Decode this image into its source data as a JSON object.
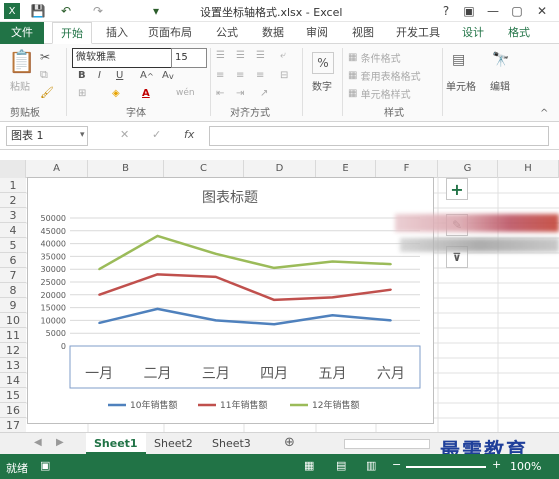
{
  "window": {
    "title": "设置坐标轴格式.xlsx - Excel",
    "help": "?",
    "minimize": "—",
    "restore": "▢",
    "close": "✕"
  },
  "qat": {
    "save_icon": "save-icon",
    "undo_icon": "undo-icon",
    "redo_icon": "redo-icon"
  },
  "tabs": [
    {
      "label": "文件"
    },
    {
      "label": "开始"
    },
    {
      "label": "插入"
    },
    {
      "label": "页面布局"
    },
    {
      "label": "公式"
    },
    {
      "label": "数据"
    },
    {
      "label": "审阅"
    },
    {
      "label": "视图"
    },
    {
      "label": "开发工具"
    },
    {
      "label": "设计"
    },
    {
      "label": "格式"
    }
  ],
  "ribbon": {
    "paste": "粘贴",
    "clipboard": "剪贴板",
    "font_name": "微软雅黑",
    "font_size": "15",
    "bold": "B",
    "italic": "I",
    "underline": "U",
    "font_group": "字体",
    "align_group": "对齐方式",
    "number": "数字",
    "percent": "%",
    "cond_format": "条件格式",
    "table_format": "套用表格格式",
    "cell_style": "单元格样式",
    "style_group": "样式",
    "cells": "单元格",
    "edit": "编辑"
  },
  "formula_bar": {
    "name_box": "图表 1",
    "fx": "fx"
  },
  "columns": [
    "A",
    "B",
    "C",
    "D",
    "E",
    "F",
    "G",
    "H"
  ],
  "rows": [
    "1",
    "2",
    "3",
    "4",
    "5",
    "6",
    "7",
    "8",
    "9",
    "10",
    "11",
    "12",
    "13",
    "14",
    "15",
    "16",
    "17"
  ],
  "sheets": [
    {
      "label": "Sheet1"
    },
    {
      "label": "Sheet2"
    },
    {
      "label": "Sheet3"
    }
  ],
  "status": {
    "ready": "就绪",
    "zoom": "100%"
  },
  "watermark": "最需教育",
  "chart_data": {
    "type": "line",
    "title": "图表标题",
    "categories": [
      "一月",
      "二月",
      "三月",
      "四月",
      "五月",
      "六月"
    ],
    "ylim": [
      0,
      50000
    ],
    "yticks": [
      "50000",
      "45000",
      "40000",
      "35000",
      "30000",
      "25000",
      "20000",
      "15000",
      "10000",
      "5000",
      "0"
    ],
    "grid": true,
    "legend": "bottom",
    "series": [
      {
        "name": "10年销售额",
        "color": "#4f81bd",
        "values": [
          9000,
          14500,
          10000,
          8500,
          12000,
          10000
        ]
      },
      {
        "name": "11年销售额",
        "color": "#c0504d",
        "values": [
          20000,
          28000,
          27000,
          18000,
          19000,
          22000
        ]
      },
      {
        "name": "12年销售额",
        "color": "#9bbb59",
        "values": [
          30000,
          43000,
          36000,
          30500,
          33000,
          32000
        ]
      }
    ]
  }
}
